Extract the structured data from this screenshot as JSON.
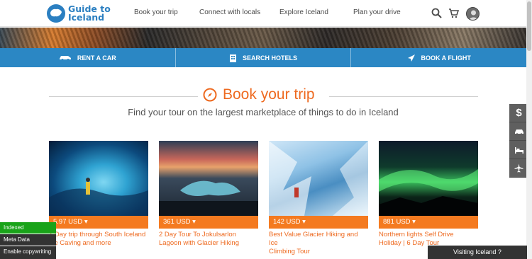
{
  "header": {
    "logo_line1": "Guide to",
    "logo_line2": "Iceland",
    "nav": [
      "Book your trip",
      "Connect with locals",
      "Explore Iceland",
      "Plan your drive"
    ]
  },
  "bluebar": {
    "items": [
      "RENT A CAR",
      "SEARCH HOTELS",
      "BOOK A FLIGHT"
    ]
  },
  "section": {
    "title": "Book your trip",
    "subtitle": "Find your tour on the largest marketplace of things to do in Iceland"
  },
  "side_widgets": {
    "currency_symbol": "$",
    "icons": [
      "dollar-icon",
      "car-icon",
      "bed-icon",
      "plane-icon"
    ]
  },
  "cards": [
    {
      "price": "5.97 USD ▾",
      "title_line1": "1 Day trip through South Iceland",
      "title_line2": "Ice Caving and more"
    },
    {
      "price": "361 USD ▾",
      "title_line1": "2 Day Tour To Jokulsarlon",
      "title_line2": "Lagoon with Glacier Hiking"
    },
    {
      "price": "142 USD ▾",
      "title_line1": "Best Value Glacier Hiking and Ice",
      "title_line2": "Climbing Tour"
    },
    {
      "price": "881 USD ▾",
      "title_line1": "Northern lights Self Drive",
      "title_line2": "Holiday | 6 Day Tour"
    }
  ],
  "overlays": {
    "indexed": "Indexed",
    "meta_data": "Meta Data",
    "enable_copywriting": "Enable copywriting",
    "visiting": "Visiting Iceland ?"
  },
  "colors": {
    "accent_orange": "#ee6a20",
    "brand_blue": "#2b87c4"
  }
}
